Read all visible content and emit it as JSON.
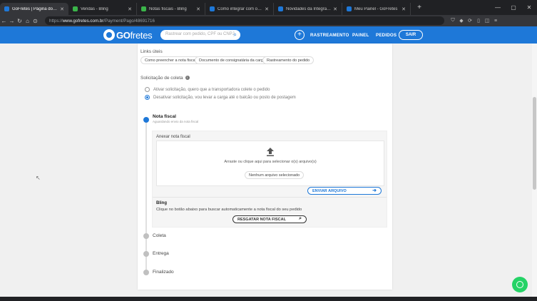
{
  "browser": {
    "tabs": [
      {
        "title": "GoFretes | Página do pedido",
        "color": "#1e78d8",
        "active": true
      },
      {
        "title": "Vendas - Bling",
        "color": "#3bb54a",
        "active": false
      },
      {
        "title": "Notas fiscais - Bling",
        "color": "#3bb54a",
        "active": false
      },
      {
        "title": "Como integrar com o Bling - Central",
        "color": "#1e78d8",
        "active": false
      },
      {
        "title": "Novidades da Integração GoFretes x",
        "color": "#1e78d8",
        "active": false
      },
      {
        "title": "Meu Painel - GoFretes",
        "color": "#1e78d8",
        "active": false
      }
    ],
    "url_prefix": "https://",
    "url_host": "www.gofretes.com.br",
    "url_path": "/Payment/Pago/48691716"
  },
  "header": {
    "logo_go": "GO",
    "logo_fretes": "fretes",
    "search_placeholder": "Rastrear com pedido, CPF ou CNPJ",
    "nav": [
      "RASTREAMENTO",
      "PAINEL",
      "PEDIDOS"
    ],
    "logout": "SAIR"
  },
  "links_uteis": {
    "title": "Links úteis",
    "chips": [
      "Como preencher a nota fiscal",
      "Documento de consignatária da carga",
      "Rastreamento do pedido"
    ]
  },
  "coleta": {
    "title": "Solicitação de coleta",
    "options": [
      {
        "label": "Ativar solicitação, quero que a transportadora colete o pedido",
        "selected": false
      },
      {
        "label": "Desativar solicitação, vou levar a carga até o balcão ou posto de postagem",
        "selected": true
      }
    ]
  },
  "steps": {
    "nota_fiscal": {
      "title": "Nota fiscal",
      "subtitle": "Aguardando envio da nota fiscal"
    },
    "coleta": "Coleta",
    "entrega": "Entrega",
    "finalizado": "Finalizado"
  },
  "upload": {
    "title": "Anexar nota fiscal",
    "drop_text": "Arraste ou clique aqui para selecionar o(s) arquivo(s)",
    "no_file": "Nenhum arquivo selecionado",
    "send_button": "ENVIAR ARQUIVO"
  },
  "bling": {
    "title": "Bling",
    "description": "Clique no botão abaixo para buscar automaticamente a nota fiscal do seu pedido",
    "button": "RESGATAR NOTA FISCAL"
  },
  "icons": {
    "upload": "upload-icon",
    "whatsapp": "whatsapp-icon",
    "search": "search-icon"
  },
  "colors": {
    "brand_blue": "#1e78d8",
    "whatsapp_green": "#25d366"
  }
}
